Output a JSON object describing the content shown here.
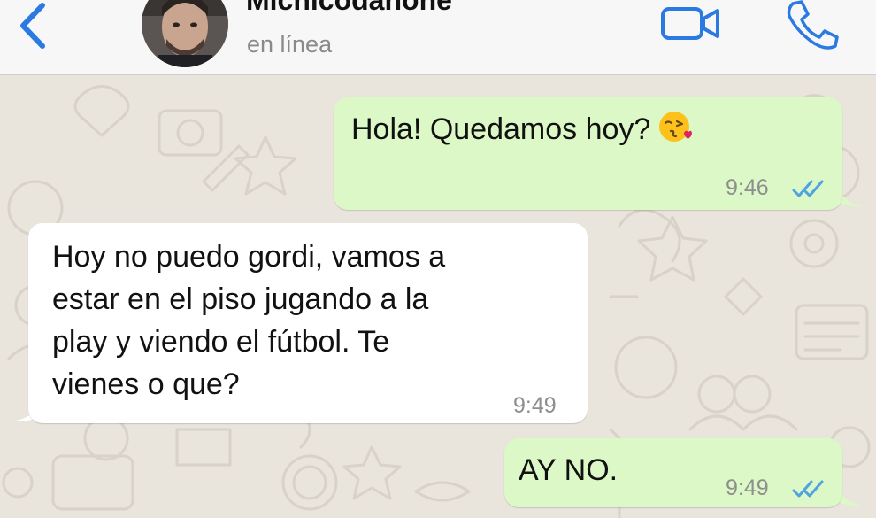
{
  "header": {
    "contact_name": "Michicodanone",
    "status": "en línea",
    "icons": {
      "back": "chevron-left-icon",
      "video": "video-camera-icon",
      "call": "phone-icon"
    },
    "accent_color": "#2a7ae2"
  },
  "messages": [
    {
      "direction": "outgoing",
      "text": "Hola! Quedamos hoy?",
      "emoji": "kissing-face-with-heart-emoji",
      "time": "9:46",
      "read": true
    },
    {
      "direction": "incoming",
      "lines": [
        "Hoy no puedo gordi, vamos a",
        "estar en el piso jugando a la",
        "play y viendo el fútbol. Te",
        "vienes o que?"
      ],
      "time": "9:49"
    },
    {
      "direction": "outgoing",
      "text": "AY NO.",
      "time": "9:49",
      "read": true
    }
  ],
  "colors": {
    "outgoing_bubble": "#dcf8c6",
    "incoming_bubble": "#ffffff",
    "chat_background": "#e9e4dc",
    "read_ticks": "#4fa3e0"
  }
}
